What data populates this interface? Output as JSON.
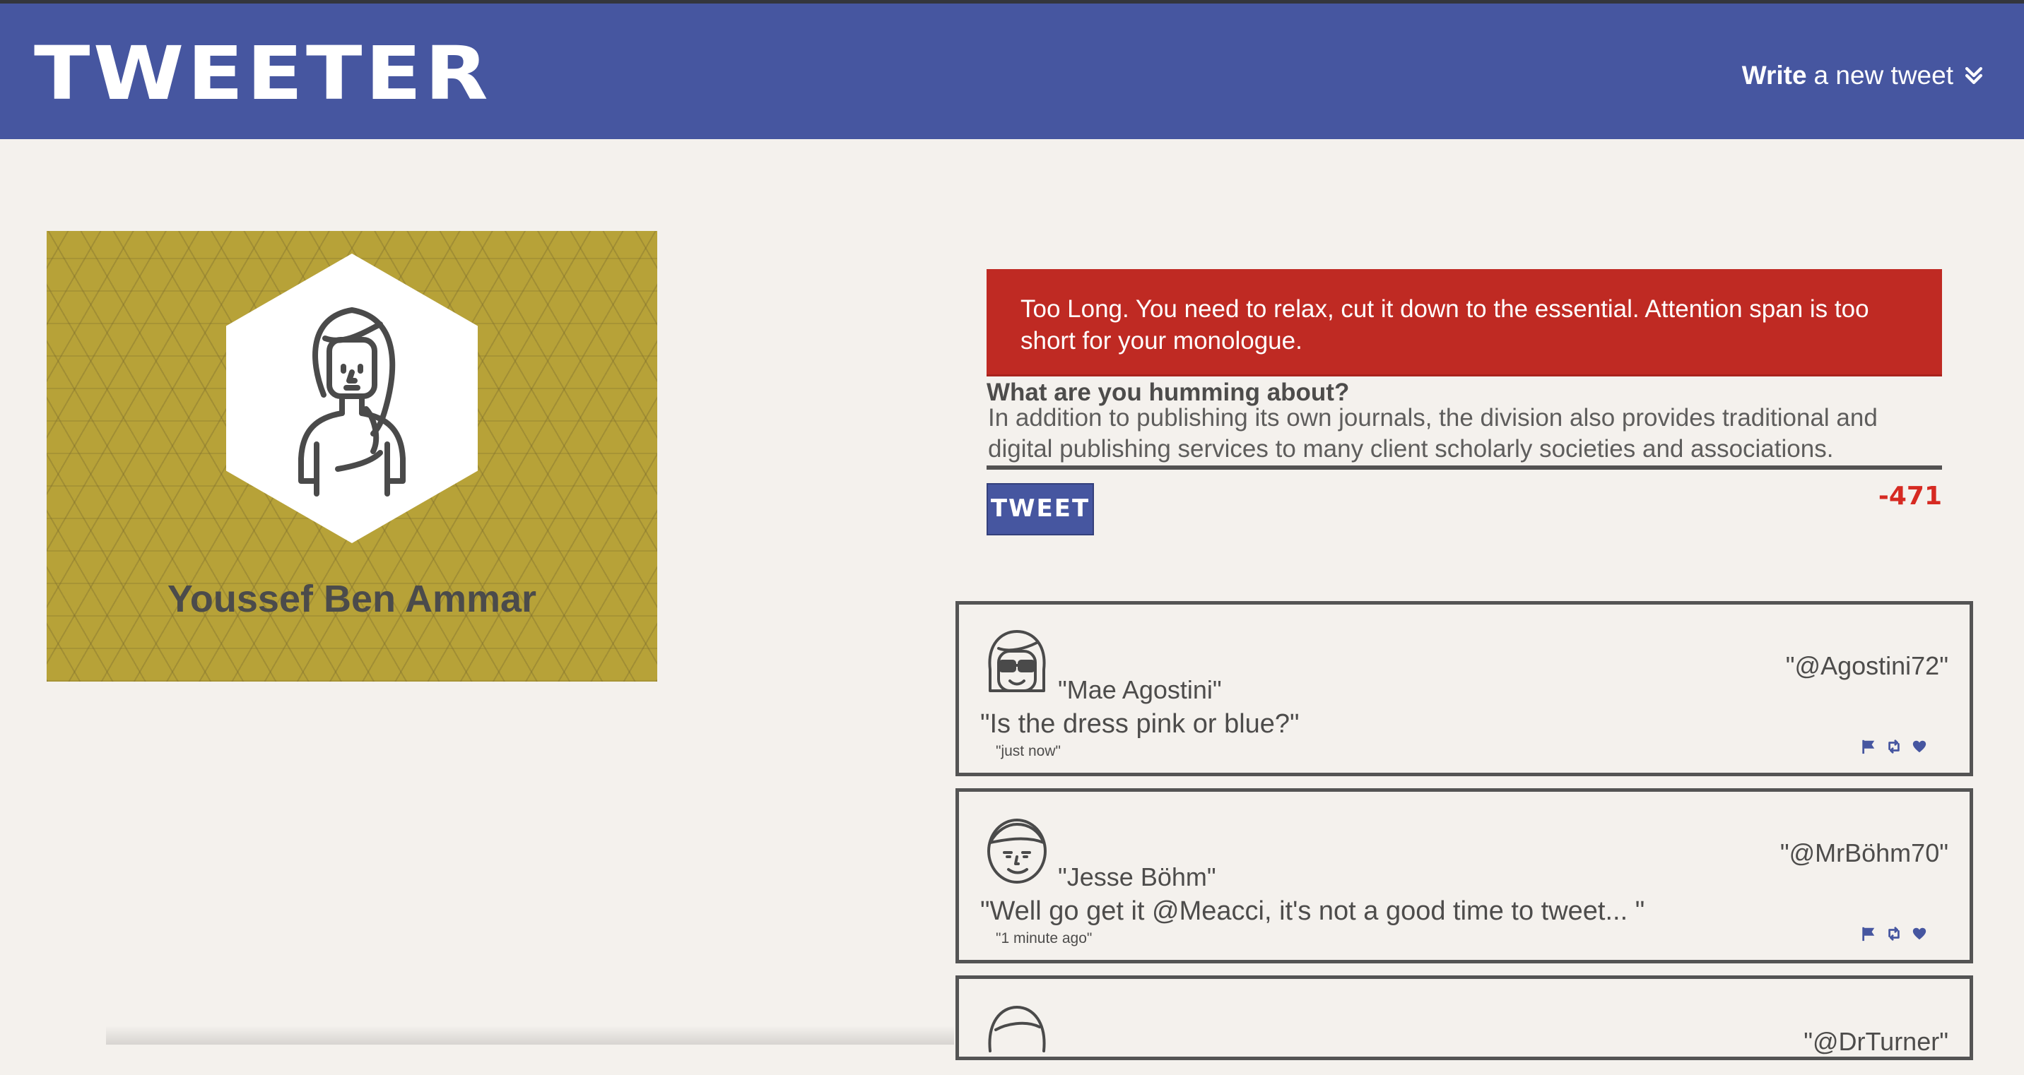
{
  "nav": {
    "brand": "TWEETER",
    "compose_strong": "Write",
    "compose_rest": "a new tweet",
    "accent": "#4656a0"
  },
  "profile": {
    "name": "Youssef Ben Ammar",
    "avatar_icon": "woman-avatar-icon"
  },
  "composer": {
    "error": "Too Long. You need to relax, cut it down to the essential. Attention span is too short for your monologue.",
    "label": "What are you humming about?",
    "text": "In addition to publishing its own journals, the division also provides traditional and digital publishing services to many client scholarly societies and associations.",
    "button": "TWEET",
    "counter": "-471",
    "error_color": "#bf2a23"
  },
  "tweets": [
    {
      "name": "\"Mae Agostini\"",
      "handle": "\"@Agostini72\"",
      "content": "\"Is the dress pink or blue?\"",
      "time": "\"just now\"",
      "avatar_icon": "sunglasses-woman-avatar-icon"
    },
    {
      "name": "\"Jesse Böhm\"",
      "handle": "\"@MrBöhm70\"",
      "content": "\"Well go get it @Meacci, it's not a good time to tweet... \"",
      "time": "\"1 minute ago\"",
      "avatar_icon": "man-avatar-icon"
    },
    {
      "handle": "\"@DrTurner\"",
      "avatar_icon": "avatar-icon"
    }
  ]
}
